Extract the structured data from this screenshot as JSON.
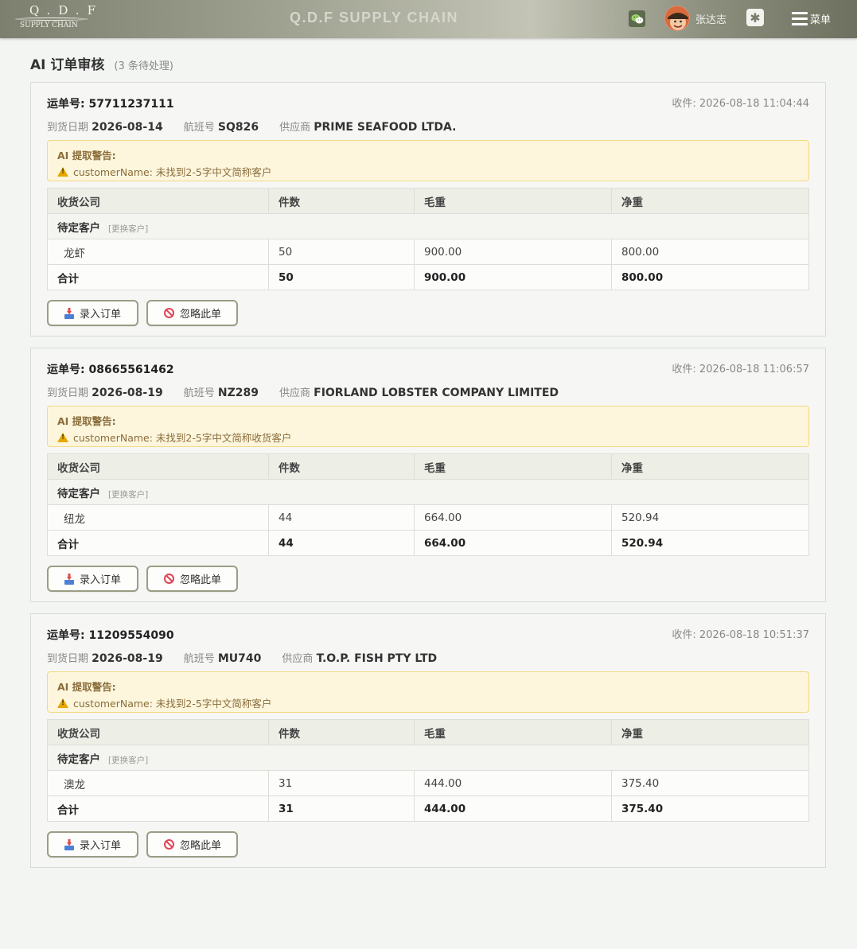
{
  "header": {
    "logo_top": "Q.D.F",
    "logo_bottom": "SUPPLY CHAIN",
    "title": "Q.D.F SUPPLY CHAIN",
    "username": "张达志",
    "menu_label": "菜单",
    "plugin_glyph": "✱"
  },
  "page": {
    "title": "AI 订单审核",
    "subtitle": "(3 条待处理)"
  },
  "labels": {
    "waybill": "运单号: ",
    "arrival": "到货日期",
    "flight": "航班号",
    "supplier": "供应商",
    "warning_title": "AI 提取警告:",
    "col_company": "收货公司",
    "col_pieces": "件数",
    "col_gross": "毛重",
    "col_net": "净重",
    "pending_customer": "待定客户",
    "change_customer": "[更换客户]",
    "total": "合计",
    "import_button": "录入订单",
    "ignore_button": "忽略此单"
  },
  "orders": [
    {
      "waybill": "57711237111",
      "received": "收件: 2026-08-18 11:04:44",
      "arrival": "2026-08-14",
      "flight": "SQ826",
      "supplier": "PRIME SEAFOOD LTDA.",
      "warning": "customerName: 未找到2-5字中文简称客户",
      "item": {
        "name": "龙虾",
        "pieces": "50",
        "gross": "900.00",
        "net": "800.00"
      },
      "total": {
        "pieces": "50",
        "gross": "900.00",
        "net": "800.00"
      }
    },
    {
      "waybill": "08665561462",
      "received": "收件: 2026-08-18 11:06:57",
      "arrival": "2026-08-19",
      "flight": "NZ289",
      "supplier": "FIORLAND LOBSTER COMPANY LIMITED",
      "warning": "customerName: 未找到2-5字中文简称收货客户",
      "item": {
        "name": "纽龙",
        "pieces": "44",
        "gross": "664.00",
        "net": "520.94"
      },
      "total": {
        "pieces": "44",
        "gross": "664.00",
        "net": "520.94"
      }
    },
    {
      "waybill": "11209554090",
      "received": "收件: 2026-08-18 10:51:37",
      "arrival": "2026-08-19",
      "flight": "MU740",
      "supplier": "T.O.P. FISH PTY LTD",
      "warning": "customerName: 未找到2-5字中文简称客户",
      "item": {
        "name": "澳龙",
        "pieces": "31",
        "gross": "444.00",
        "net": "375.40"
      },
      "total": {
        "pieces": "31",
        "gross": "444.00",
        "net": "375.40"
      }
    }
  ],
  "colors": {
    "header_gradient_mid": "#c3c4b5",
    "warning_bg": "#fdf6dd",
    "warning_text": "#8a6d3b",
    "button_border": "#9a9c85",
    "ban_red": "#e0455a"
  },
  "icons": {
    "wechat": "wechat-icon",
    "plugin": "plugin-icon",
    "menu": "hamburger-menu-icon",
    "warning": "warning-triangle-icon",
    "import": "inbox-download-icon",
    "ignore": "ban-icon"
  }
}
